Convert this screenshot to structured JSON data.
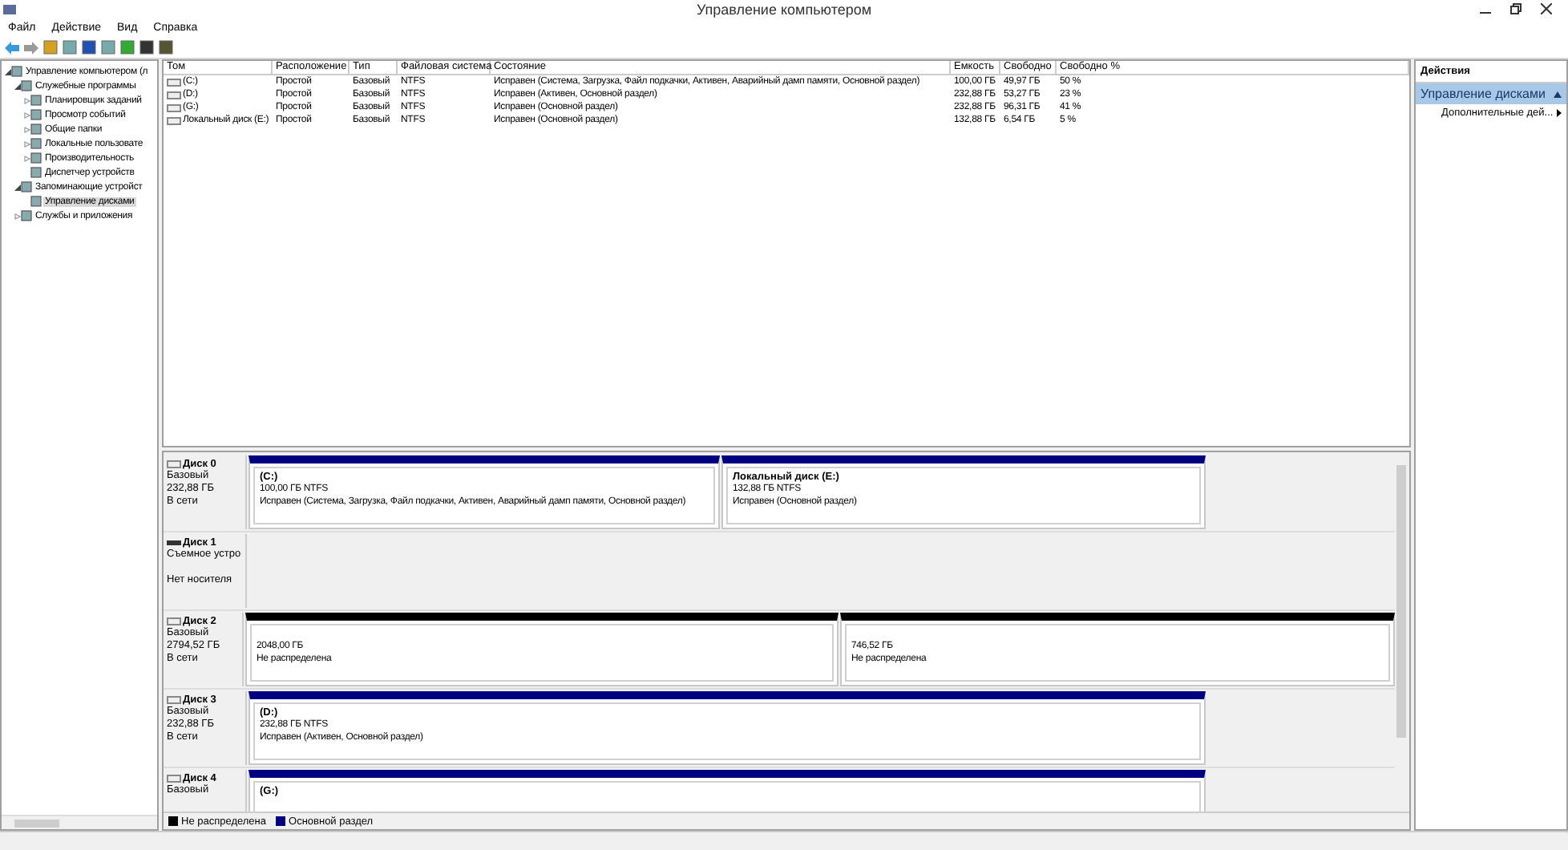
{
  "window": {
    "title": "Управление компьютером"
  },
  "menu": [
    "Файл",
    "Действие",
    "Вид",
    "Справка"
  ],
  "tree": [
    {
      "label": "Управление компьютером (л",
      "expanded": true,
      "selected": false,
      "children": [
        {
          "label": "Служебные программы",
          "expanded": true,
          "selected": false,
          "children": [
            {
              "label": "Планировщик заданий",
              "expanded": false,
              "selected": false
            },
            {
              "label": "Просмотр событий",
              "expanded": false,
              "selected": false
            },
            {
              "label": "Общие папки",
              "expanded": false,
              "selected": false
            },
            {
              "label": "Локальные пользовате",
              "expanded": false,
              "selected": false
            },
            {
              "label": "Производительность",
              "expanded": false,
              "selected": false
            },
            {
              "label": "Диспетчер устройств",
              "selected": false
            }
          ]
        },
        {
          "label": "Запоминающие устройст",
          "expanded": true,
          "selected": false,
          "children": [
            {
              "label": "Управление дисками",
              "selected": true
            }
          ]
        },
        {
          "label": "Службы и приложения",
          "expanded": false,
          "selected": false
        }
      ]
    }
  ],
  "table": {
    "columns": [
      "Том",
      "Расположение",
      "Тип",
      "Файловая система",
      "Состояние",
      "Емкость",
      "Свободно",
      "Свободно %"
    ],
    "rows": [
      [
        "(C:)",
        "Простой",
        "Базовый",
        "NTFS",
        "Исправен (Система, Загрузка, Файл подкачки, Активен, Аварийный дамп памяти, Основной раздел)",
        "100,00 ГБ",
        "49,97 ГБ",
        "50 %"
      ],
      [
        "(D:)",
        "Простой",
        "Базовый",
        "NTFS",
        "Исправен (Активен, Основной раздел)",
        "232,88 ГБ",
        "53,27 ГБ",
        "23 %"
      ],
      [
        "(G:)",
        "Простой",
        "Базовый",
        "NTFS",
        "Исправен (Основной раздел)",
        "232,88 ГБ",
        "96,31 ГБ",
        "41 %"
      ],
      [
        "Локальный диск (E:)",
        "Простой",
        "Базовый",
        "NTFS",
        "Исправен (Основной раздел)",
        "132,88 ГБ",
        "6,54 ГБ",
        "5 %"
      ]
    ]
  },
  "disks": [
    {
      "name": "Диск 0",
      "kind": "basic",
      "type": "Базовый",
      "size": "232,88 ГБ",
      "status": "В сети",
      "partitions": [
        {
          "kind": "primary",
          "title": "(C:)",
          "size": "100,00 ГБ NTFS",
          "status": "Исправен (Система, Загрузка, Файл подкачки, Активен, Аварийный дамп памяти, Основной раздел)"
        },
        {
          "kind": "primary",
          "title": "Локальный диск  (E:)",
          "size": "132,88 ГБ NTFS",
          "status": "Исправен (Основной раздел)"
        }
      ]
    },
    {
      "name": "Диск 1",
      "kind": "removable",
      "type": "Съемное устро",
      "status": "Нет носителя"
    },
    {
      "name": "Диск 2",
      "kind": "basic",
      "type": "Базовый",
      "size": "2794,52 ГБ",
      "status": "В сети",
      "partitions": [
        {
          "kind": "unallocated",
          "size": "2048,00 ГБ",
          "status": "Не распределена"
        },
        {
          "kind": "unallocated",
          "size": "746,52 ГБ",
          "status": "Не распределена"
        }
      ]
    },
    {
      "name": "Диск 3",
      "kind": "basic",
      "type": "Базовый",
      "size": "232,88 ГБ",
      "status": "В сети",
      "partitions": [
        {
          "kind": "primary",
          "title": "(D:)",
          "size": "232,88 ГБ NTFS",
          "status": "Исправен (Активен, Основной раздел)"
        }
      ]
    },
    {
      "name": "Диск 4",
      "kind": "basic",
      "type": "Базовый",
      "partitions": [
        {
          "kind": "primary",
          "title": "(G:)"
        }
      ]
    }
  ],
  "legend": [
    {
      "kind": "unallocated",
      "label": "Не распределена"
    },
    {
      "kind": "primary",
      "label": "Основной раздел"
    }
  ],
  "actions": {
    "title": "Действия",
    "section": "Управление дисками",
    "items": [
      "Дополнительные дей..."
    ]
  }
}
